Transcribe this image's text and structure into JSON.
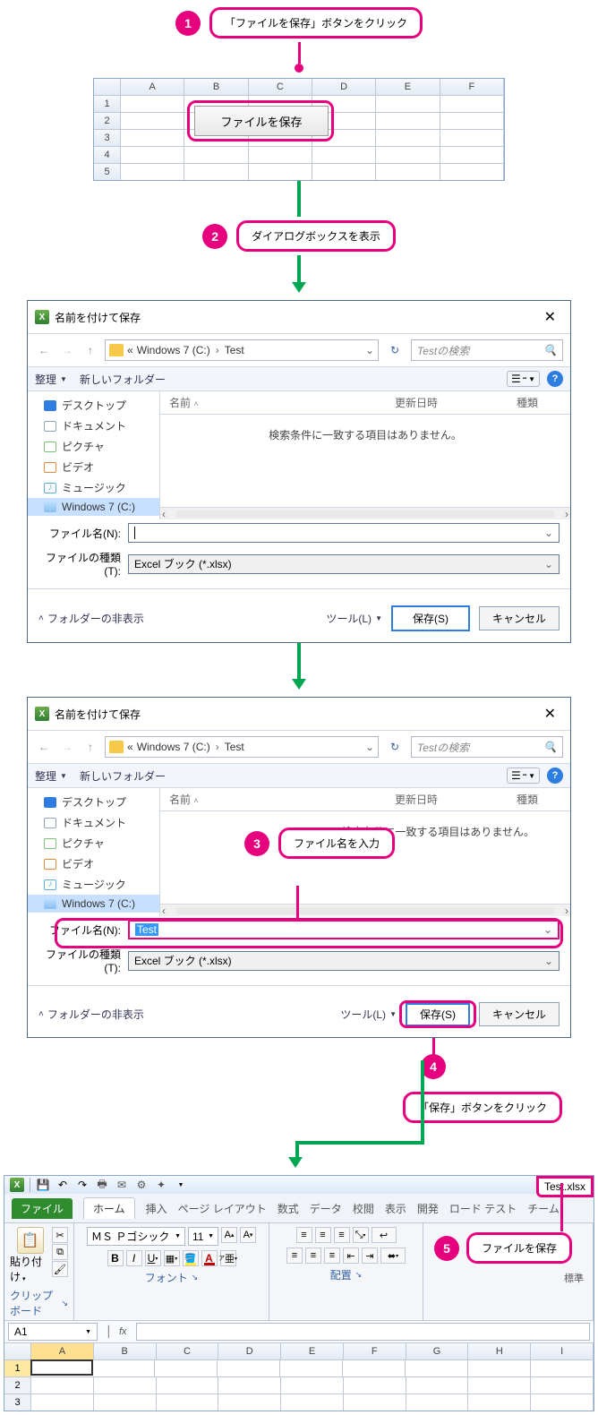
{
  "step1": {
    "num": "1",
    "label": "「ファイルを保存」ボタンをクリック"
  },
  "step2": {
    "num": "2",
    "label": "ダイアログボックスを表示"
  },
  "step3": {
    "num": "3",
    "label": "ファイル名を入力"
  },
  "step4": {
    "num": "4",
    "label": "「保存」ボタンをクリック"
  },
  "step5": {
    "num": "5",
    "label": "ファイルを保存"
  },
  "sheet": {
    "cols": [
      "A",
      "B",
      "C",
      "D",
      "E",
      "F"
    ],
    "rows": [
      "1",
      "2",
      "3",
      "4",
      "5"
    ],
    "button": "ファイルを保存"
  },
  "dialog": {
    "title": "名前を付けて保存",
    "crumb_prefix": "«",
    "crumb1": "Windows 7 (C:)",
    "crumb2": "Test",
    "search_placeholder": "Testの検索",
    "organize": "整理",
    "newfolder": "新しいフォルダー",
    "tree": {
      "desktop": "デスクトップ",
      "documents": "ドキュメント",
      "pictures": "ピクチャ",
      "videos": "ビデオ",
      "music": "ミュージック",
      "drive": "Windows 7 (C:)"
    },
    "col_name": "名前",
    "col_date": "更新日時",
    "col_type": "種類",
    "noitems": "検索条件に一致する項目はありません。",
    "filename_label": "ファイル名(N):",
    "filetype_label": "ファイルの種類(T):",
    "filetype_value": "Excel ブック (*.xlsx)",
    "filename_value2": "Test",
    "hide_folders": "フォルダーの非表示",
    "tools": "ツール(L)",
    "save": "保存(S)",
    "cancel": "キャンセル"
  },
  "ribbon": {
    "filetitle": "Test.xlsx",
    "tab_file": "ファイル",
    "tab_home": "ホーム",
    "tab_insert": "挿入",
    "tab_pagelayout": "ページ レイアウト",
    "tab_formula": "数式",
    "tab_data": "データ",
    "tab_review": "校閲",
    "tab_view": "表示",
    "tab_dev": "開発",
    "tab_loadtest": "ロード テスト",
    "tab_team": "チーム",
    "paste": "貼り付け",
    "clipboard": "クリップボード",
    "font_group": "フォント",
    "align_group": "配置",
    "font": "ＭＳ Ｐゴシック",
    "size": "11",
    "style_normal": "標準",
    "cell_a1": "A1",
    "cols": [
      "A",
      "B",
      "C",
      "D",
      "E",
      "F",
      "G",
      "H",
      "I"
    ],
    "rows": [
      "1",
      "2",
      "3"
    ]
  }
}
